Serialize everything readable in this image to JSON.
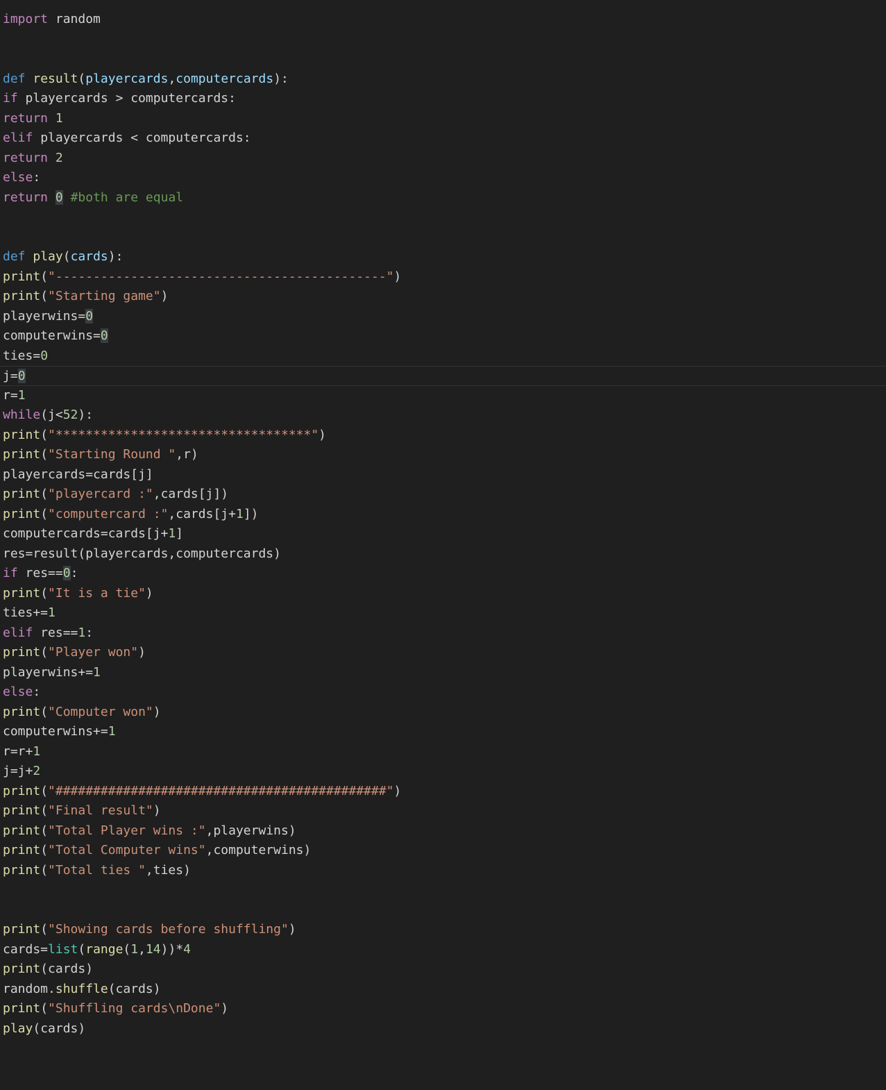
{
  "colors": {
    "background": "#1f1f1f",
    "text": "#d4d4d4",
    "keyword_control": "#c586c0",
    "keyword_def": "#569cd6",
    "function": "#dcdcaa",
    "parameter": "#9cdcfe",
    "string": "#ce9178",
    "number": "#b5cea8",
    "comment": "#6a9955",
    "builtin": "#4ec9b0"
  },
  "editor": {
    "language": "python",
    "lines": [
      [
        {
          "t": "import",
          "c": "kw-ctrl"
        },
        {
          "t": " random",
          "c": "plain"
        }
      ],
      [],
      [],
      [
        {
          "t": "def",
          "c": "kw-def"
        },
        {
          "t": " ",
          "c": "plain"
        },
        {
          "t": "result",
          "c": "fn"
        },
        {
          "t": "(",
          "c": "plain"
        },
        {
          "t": "playercards",
          "c": "param"
        },
        {
          "t": ",",
          "c": "plain"
        },
        {
          "t": "computercards",
          "c": "param"
        },
        {
          "t": "):",
          "c": "plain"
        }
      ],
      [
        {
          "t": "if",
          "c": "kw-ctrl"
        },
        {
          "t": " playercards > computercards:",
          "c": "plain"
        }
      ],
      [
        {
          "t": "return",
          "c": "kw-ctrl"
        },
        {
          "t": " ",
          "c": "plain"
        },
        {
          "t": "1",
          "c": "num"
        }
      ],
      [
        {
          "t": "elif",
          "c": "kw-ctrl"
        },
        {
          "t": " playercards < computercards:",
          "c": "plain"
        }
      ],
      [
        {
          "t": "return",
          "c": "kw-ctrl"
        },
        {
          "t": " ",
          "c": "plain"
        },
        {
          "t": "2",
          "c": "num"
        }
      ],
      [
        {
          "t": "else",
          "c": "kw-ctrl"
        },
        {
          "t": ":",
          "c": "plain"
        }
      ],
      [
        {
          "t": "return",
          "c": "kw-ctrl"
        },
        {
          "t": " ",
          "c": "plain"
        },
        {
          "t": "0",
          "c": "num hl"
        },
        {
          "t": " ",
          "c": "plain"
        },
        {
          "t": "#both are equal",
          "c": "cmt"
        }
      ],
      [],
      [],
      [
        {
          "t": "def",
          "c": "kw-def"
        },
        {
          "t": " ",
          "c": "plain"
        },
        {
          "t": "play",
          "c": "fn"
        },
        {
          "t": "(",
          "c": "plain"
        },
        {
          "t": "cards",
          "c": "param"
        },
        {
          "t": "):",
          "c": "plain"
        }
      ],
      [
        {
          "t": "print",
          "c": "fn"
        },
        {
          "t": "(",
          "c": "plain"
        },
        {
          "t": "\"--------------------------------------------\"",
          "c": "str"
        },
        {
          "t": ")",
          "c": "plain"
        }
      ],
      [
        {
          "t": "print",
          "c": "fn"
        },
        {
          "t": "(",
          "c": "plain"
        },
        {
          "t": "\"Starting game\"",
          "c": "str"
        },
        {
          "t": ")",
          "c": "plain"
        }
      ],
      [
        {
          "t": "playerwins=",
          "c": "plain"
        },
        {
          "t": "0",
          "c": "num hl"
        }
      ],
      [
        {
          "t": "computerwins=",
          "c": "plain"
        },
        {
          "t": "0",
          "c": "num hl"
        }
      ],
      [
        {
          "t": "ties=",
          "c": "plain"
        },
        {
          "t": "0",
          "c": "num"
        }
      ],
      [
        {
          "t": "j=",
          "c": "plain"
        },
        {
          "t": "0",
          "c": "num hl"
        }
      ],
      [
        {
          "t": "r=",
          "c": "plain"
        },
        {
          "t": "1",
          "c": "num"
        }
      ],
      [
        {
          "t": "while",
          "c": "kw-ctrl"
        },
        {
          "t": "(j<",
          "c": "plain"
        },
        {
          "t": "52",
          "c": "num"
        },
        {
          "t": "):",
          "c": "plain"
        }
      ],
      [
        {
          "t": "print",
          "c": "fn"
        },
        {
          "t": "(",
          "c": "plain"
        },
        {
          "t": "\"**********************************\"",
          "c": "str"
        },
        {
          "t": ")",
          "c": "plain"
        }
      ],
      [
        {
          "t": "print",
          "c": "fn"
        },
        {
          "t": "(",
          "c": "plain"
        },
        {
          "t": "\"Starting Round \"",
          "c": "str"
        },
        {
          "t": ",r)",
          "c": "plain"
        }
      ],
      [
        {
          "t": "playercards=cards[j]",
          "c": "plain"
        }
      ],
      [
        {
          "t": "print",
          "c": "fn"
        },
        {
          "t": "(",
          "c": "plain"
        },
        {
          "t": "\"playercard :\"",
          "c": "str"
        },
        {
          "t": ",cards[j])",
          "c": "plain"
        }
      ],
      [
        {
          "t": "print",
          "c": "fn"
        },
        {
          "t": "(",
          "c": "plain"
        },
        {
          "t": "\"computercard :\"",
          "c": "str"
        },
        {
          "t": ",cards[j+",
          "c": "plain"
        },
        {
          "t": "1",
          "c": "num"
        },
        {
          "t": "])",
          "c": "plain"
        }
      ],
      [
        {
          "t": "computercards=cards[j+",
          "c": "plain"
        },
        {
          "t": "1",
          "c": "num"
        },
        {
          "t": "]",
          "c": "plain"
        }
      ],
      [
        {
          "t": "res=result(playercards,computercards)",
          "c": "plain"
        }
      ],
      [
        {
          "t": "if",
          "c": "kw-ctrl"
        },
        {
          "t": " res==",
          "c": "plain"
        },
        {
          "t": "0",
          "c": "num hl"
        },
        {
          "t": ":",
          "c": "plain"
        }
      ],
      [
        {
          "t": "print",
          "c": "fn"
        },
        {
          "t": "(",
          "c": "plain"
        },
        {
          "t": "\"It is a tie\"",
          "c": "str"
        },
        {
          "t": ")",
          "c": "plain"
        }
      ],
      [
        {
          "t": "ties+=",
          "c": "plain"
        },
        {
          "t": "1",
          "c": "num"
        }
      ],
      [
        {
          "t": "elif",
          "c": "kw-ctrl"
        },
        {
          "t": " res==",
          "c": "plain"
        },
        {
          "t": "1",
          "c": "num"
        },
        {
          "t": ":",
          "c": "plain"
        }
      ],
      [
        {
          "t": "print",
          "c": "fn"
        },
        {
          "t": "(",
          "c": "plain"
        },
        {
          "t": "\"Player won\"",
          "c": "str"
        },
        {
          "t": ")",
          "c": "plain"
        }
      ],
      [
        {
          "t": "playerwins+=",
          "c": "plain"
        },
        {
          "t": "1",
          "c": "num"
        }
      ],
      [
        {
          "t": "else",
          "c": "kw-ctrl"
        },
        {
          "t": ":",
          "c": "plain"
        }
      ],
      [
        {
          "t": "print",
          "c": "fn"
        },
        {
          "t": "(",
          "c": "plain"
        },
        {
          "t": "\"Computer won\"",
          "c": "str"
        },
        {
          "t": ")",
          "c": "plain"
        }
      ],
      [
        {
          "t": "computerwins+=",
          "c": "plain"
        },
        {
          "t": "1",
          "c": "num"
        }
      ],
      [
        {
          "t": "r=r+",
          "c": "plain"
        },
        {
          "t": "1",
          "c": "num"
        }
      ],
      [
        {
          "t": "j=j+",
          "c": "plain"
        },
        {
          "t": "2",
          "c": "num"
        }
      ],
      [
        {
          "t": "print",
          "c": "fn"
        },
        {
          "t": "(",
          "c": "plain"
        },
        {
          "t": "\"############################################\"",
          "c": "str"
        },
        {
          "t": ")",
          "c": "plain"
        }
      ],
      [
        {
          "t": "print",
          "c": "fn"
        },
        {
          "t": "(",
          "c": "plain"
        },
        {
          "t": "\"Final result\"",
          "c": "str"
        },
        {
          "t": ")",
          "c": "plain"
        }
      ],
      [
        {
          "t": "print",
          "c": "fn"
        },
        {
          "t": "(",
          "c": "plain"
        },
        {
          "t": "\"Total Player wins :\"",
          "c": "str"
        },
        {
          "t": ",playerwins)",
          "c": "plain"
        }
      ],
      [
        {
          "t": "print",
          "c": "fn"
        },
        {
          "t": "(",
          "c": "plain"
        },
        {
          "t": "\"Total Computer wins\"",
          "c": "str"
        },
        {
          "t": ",computerwins)",
          "c": "plain"
        }
      ],
      [
        {
          "t": "print",
          "c": "fn"
        },
        {
          "t": "(",
          "c": "plain"
        },
        {
          "t": "\"Total ties \"",
          "c": "str"
        },
        {
          "t": ",ties)",
          "c": "plain"
        }
      ],
      [],
      [],
      [
        {
          "t": "print",
          "c": "fn"
        },
        {
          "t": "(",
          "c": "plain"
        },
        {
          "t": "\"Showing cards before shuffling\"",
          "c": "str"
        },
        {
          "t": ")",
          "c": "plain"
        }
      ],
      [
        {
          "t": "cards=",
          "c": "plain"
        },
        {
          "t": "list",
          "c": "builtin"
        },
        {
          "t": "(",
          "c": "plain"
        },
        {
          "t": "range",
          "c": "fn"
        },
        {
          "t": "(",
          "c": "plain"
        },
        {
          "t": "1",
          "c": "num"
        },
        {
          "t": ",",
          "c": "plain"
        },
        {
          "t": "14",
          "c": "num"
        },
        {
          "t": "))*",
          "c": "plain"
        },
        {
          "t": "4",
          "c": "num"
        }
      ],
      [
        {
          "t": "print",
          "c": "fn"
        },
        {
          "t": "(cards)",
          "c": "plain"
        }
      ],
      [
        {
          "t": "random.",
          "c": "plain"
        },
        {
          "t": "shuffle",
          "c": "fn"
        },
        {
          "t": "(cards)",
          "c": "plain"
        }
      ],
      [
        {
          "t": "print",
          "c": "fn"
        },
        {
          "t": "(",
          "c": "plain"
        },
        {
          "t": "\"Shuffling cards\\nDone\"",
          "c": "str"
        },
        {
          "t": ")",
          "c": "plain"
        }
      ],
      [
        {
          "t": "play",
          "c": "fn"
        },
        {
          "t": "(cards)",
          "c": "plain"
        }
      ]
    ]
  }
}
